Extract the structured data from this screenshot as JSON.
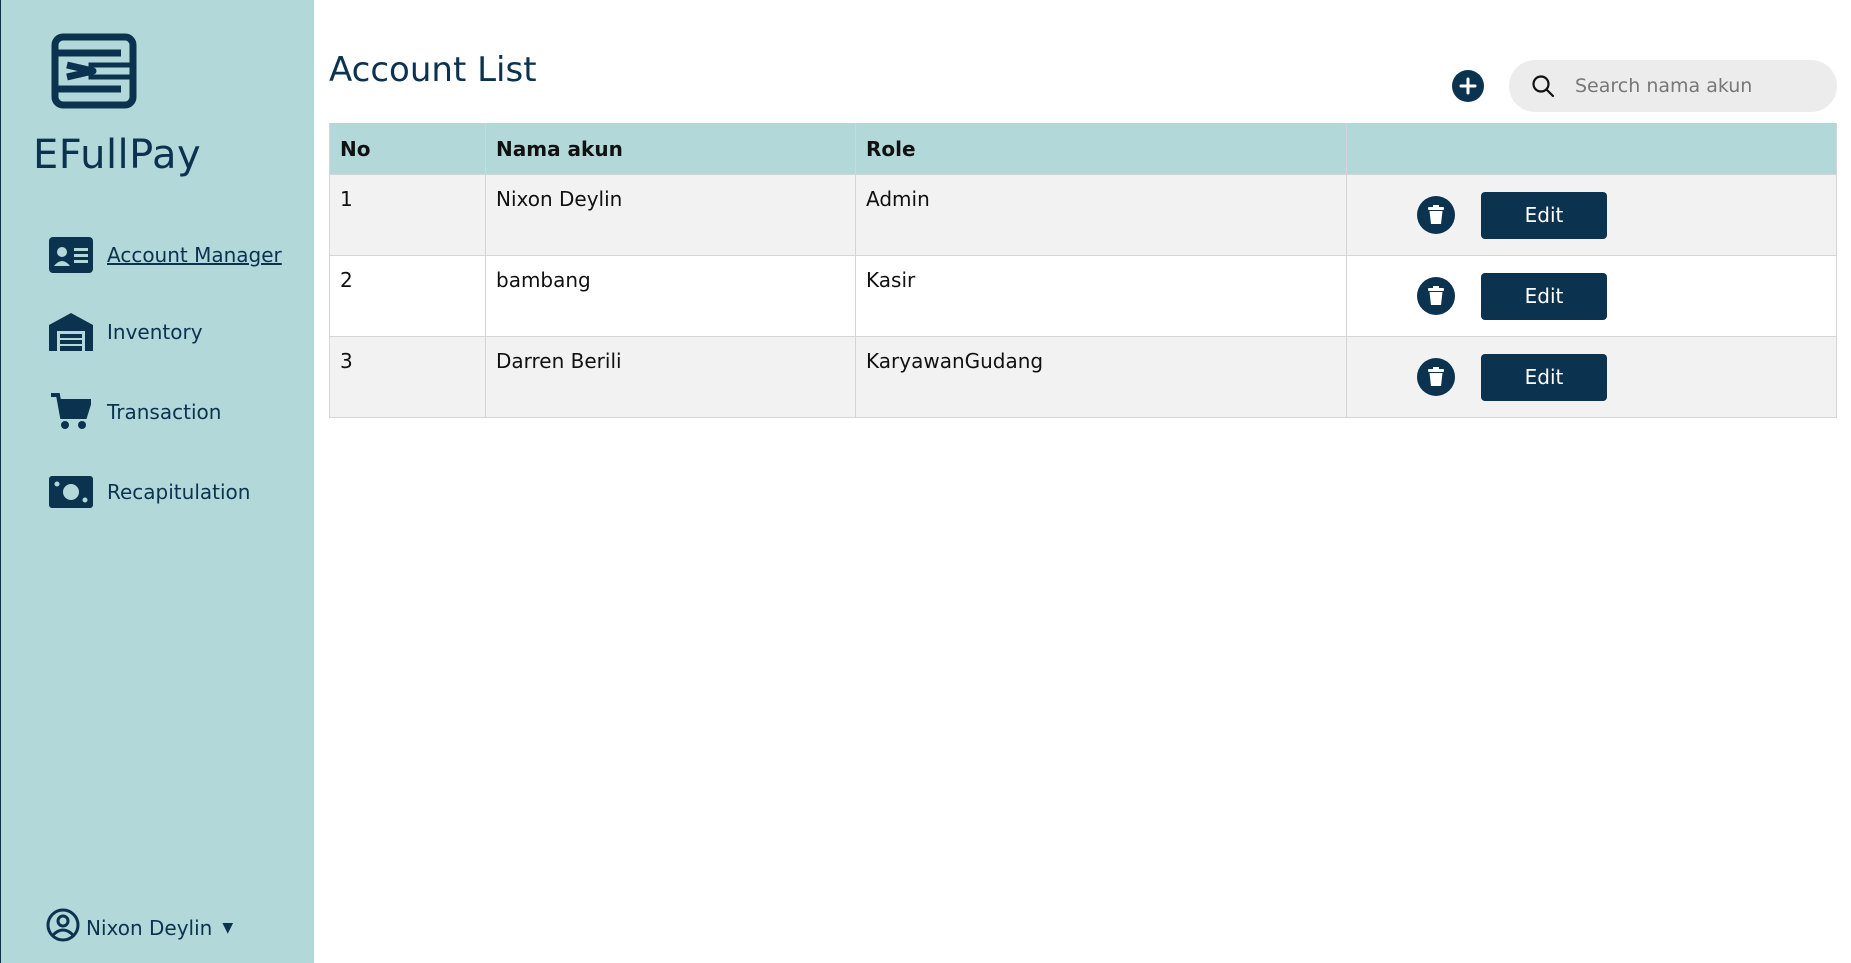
{
  "app": {
    "brand": "EFullPay"
  },
  "sidebar": {
    "items": [
      {
        "label": "Account Manager",
        "icon": "id-card-icon",
        "active": true
      },
      {
        "label": "Inventory",
        "icon": "warehouse-icon",
        "active": false
      },
      {
        "label": "Transaction",
        "icon": "cart-icon",
        "active": false
      },
      {
        "label": "Recapitulation",
        "icon": "money-bill-icon",
        "active": false
      }
    ],
    "user": {
      "name": "Nixon Deylin",
      "icon": "user-circle-icon"
    }
  },
  "main": {
    "title": "Account List",
    "search": {
      "placeholder": "Search nama akun",
      "value": ""
    },
    "table": {
      "headers": [
        "No",
        "Nama akun",
        "Role",
        ""
      ],
      "rows": [
        {
          "no": "1",
          "name": "Nixon Deylin",
          "role": "Admin"
        },
        {
          "no": "2",
          "name": "bambang",
          "role": "Kasir"
        },
        {
          "no": "3",
          "name": "Darren Berili",
          "role": "KaryawanGudang"
        }
      ],
      "edit_label": "Edit"
    }
  },
  "colors": {
    "primary": "#0b3350",
    "sidebar_bg": "#b2d8da",
    "row_alt": "#f2f2f2"
  }
}
